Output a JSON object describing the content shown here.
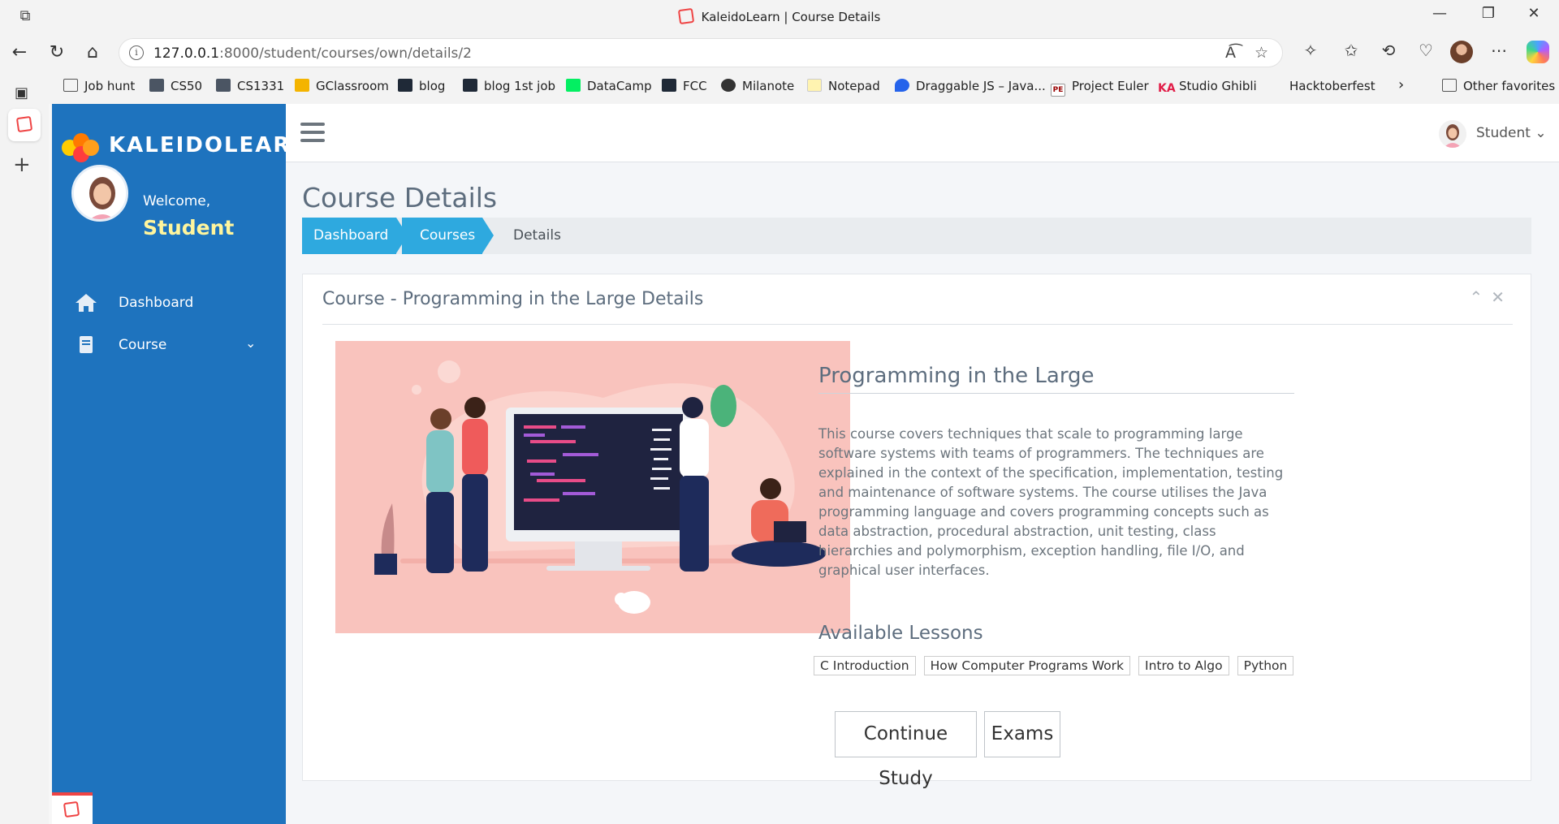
{
  "browser": {
    "window_title": "KaleidoLearn | Course Details",
    "url_host": "127.0.0.1",
    "url_rest": ":8000/student/courses/own/details/2",
    "bookmarks": [
      "Job hunt",
      "CS50",
      "CS1331",
      "GClassroom",
      "blog",
      "blog 1st job",
      "DataCamp",
      "FCC",
      "Milanote",
      "Notepad",
      "Draggable JS – Java...",
      "Project Euler",
      "Studio Ghibli",
      "Hacktoberfest"
    ],
    "other_favorites": "Other favorites"
  },
  "sidebar": {
    "brand": "KALEIDOLEARN",
    "welcome": "Welcome,",
    "user_name": "Student",
    "nav": [
      {
        "label": "Dashboard",
        "icon": "home-icon"
      },
      {
        "label": "Course",
        "icon": "book-icon"
      }
    ]
  },
  "topnav": {
    "user_label": "Student"
  },
  "page": {
    "title": "Course Details",
    "breadcrumb": [
      "Dashboard",
      "Courses",
      "Details"
    ]
  },
  "card": {
    "header": "Course - Programming in the Large Details",
    "course_name": "Programming in the Large",
    "description": "This course covers techniques that scale to programming large software systems with teams of programmers. The techniques are explained in the context of the specification, implementation, testing and maintenance of software systems. The course utilises the Java programming language and covers programming concepts such as data abstraction, procedural abstraction, unit testing, class hierarchies and polymorphism, exception handling, file I/O, and graphical user interfaces.",
    "lessons_title": "Available Lessons",
    "lessons": [
      "C Introduction",
      "How Computer Programs Work",
      "Intro to Algo",
      "Python"
    ],
    "continue_label": "Continue Study",
    "exams_label": "Exams"
  },
  "colors": {
    "sidebar": "#1e73be",
    "breadcrumb_active": "#2ea9df",
    "illustration_bg": "#f9c3bd",
    "username_yellow": "#fff59d"
  }
}
